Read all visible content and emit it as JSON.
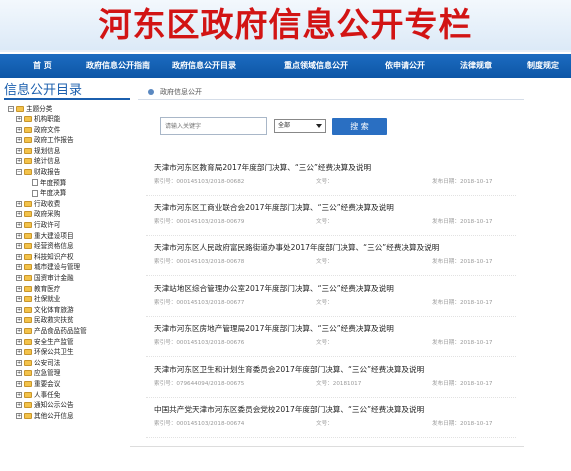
{
  "banner": {
    "title": "河东区政府信息公开专栏"
  },
  "nav": {
    "items": [
      "首 页",
      "政府信息公开指南",
      "政府信息公开目录",
      "重点领域信息公开",
      "依申请公开",
      "法律规章",
      "制度规定"
    ]
  },
  "sidebar": {
    "title": "信息公开目录",
    "tree": [
      {
        "label": "主题分类",
        "kind": "root"
      },
      {
        "label": "机构职能",
        "kind": "folder"
      },
      {
        "label": "政府文件",
        "kind": "folder"
      },
      {
        "label": "政府工作报告",
        "kind": "folder"
      },
      {
        "label": "规划信息",
        "kind": "folder"
      },
      {
        "label": "统计信息",
        "kind": "folder"
      },
      {
        "label": "财政报告",
        "kind": "open"
      },
      {
        "label": "年度预算",
        "kind": "doc"
      },
      {
        "label": "年度决算",
        "kind": "doc"
      },
      {
        "label": "行政收费",
        "kind": "folder"
      },
      {
        "label": "政府采购",
        "kind": "folder"
      },
      {
        "label": "行政许可",
        "kind": "folder"
      },
      {
        "label": "重大建设项目",
        "kind": "folder"
      },
      {
        "label": "经营资格信息",
        "kind": "folder"
      },
      {
        "label": "科技知识产权",
        "kind": "folder"
      },
      {
        "label": "城市建设与管理",
        "kind": "folder"
      },
      {
        "label": "国资审计金融",
        "kind": "folder"
      },
      {
        "label": "教育医疗",
        "kind": "folder"
      },
      {
        "label": "社保就业",
        "kind": "folder"
      },
      {
        "label": "文化体育旅游",
        "kind": "folder"
      },
      {
        "label": "民政救灾扶贫",
        "kind": "folder"
      },
      {
        "label": "产品食品药品监管",
        "kind": "folder"
      },
      {
        "label": "安全生产监管",
        "kind": "folder"
      },
      {
        "label": "环保公共卫生",
        "kind": "folder"
      },
      {
        "label": "公安司法",
        "kind": "folder"
      },
      {
        "label": "应急管理",
        "kind": "folder"
      },
      {
        "label": "重要会议",
        "kind": "folder"
      },
      {
        "label": "人事任免",
        "kind": "folder"
      },
      {
        "label": "通知公示公告",
        "kind": "folder"
      },
      {
        "label": "其他公开信息",
        "kind": "folder"
      }
    ]
  },
  "main": {
    "breadcrumb": "政府信息公开",
    "search": {
      "placeholder": "请输入关键字",
      "select_value": "全部",
      "button": "搜 索"
    },
    "items": [
      {
        "title": "天津市河东区教育局2017年度部门决算、“三公”经费决算及说明",
        "index": "索引号：000145103/2018-00682",
        "docno": "文号：",
        "date": "发布日期：2018-10-17"
      },
      {
        "title": "天津市河东区工商业联合会2017年度部门决算、“三公”经费决算及说明",
        "index": "索引号：000145103/2018-00679",
        "docno": "文号：",
        "date": "发布日期：2018-10-17"
      },
      {
        "title": "天津市河东区人民政府富民路街道办事处2017年度部门决算、“三公”经费决算及说明",
        "index": "索引号：000145103/2018-00678",
        "docno": "文号：",
        "date": "发布日期：2018-10-17"
      },
      {
        "title": "天津站地区综合管理办公室2017年度部门决算、“三公”经费决算及说明",
        "index": "索引号：000145103/2018-00677",
        "docno": "文号：",
        "date": "发布日期：2018-10-17"
      },
      {
        "title": "天津市河东区房地产管理局2017年度部门决算、“三公”经费决算及说明",
        "index": "索引号：000145103/2018-00676",
        "docno": "文号：",
        "date": "发布日期：2018-10-17"
      },
      {
        "title": "天津市河东区卫生和计划生育委员会2017年度部门决算、“三公”经费决算及说明",
        "index": "索引号：079644094/2018-00675",
        "docno": "文号：20181017",
        "date": "发布日期：2018-10-17"
      },
      {
        "title": "中国共产党天津市河东区委员会党校2017年度部门决算、“三公”经费决算及说明",
        "index": "索引号：000145103/2018-00674",
        "docno": "文号：",
        "date": "发布日期：2018-10-17"
      }
    ]
  },
  "colors": {
    "nav_bg": "#0d56a6",
    "title_red": "#d21414",
    "accent_blue": "#1b5fae",
    "button_blue": "#2a6fc2"
  }
}
